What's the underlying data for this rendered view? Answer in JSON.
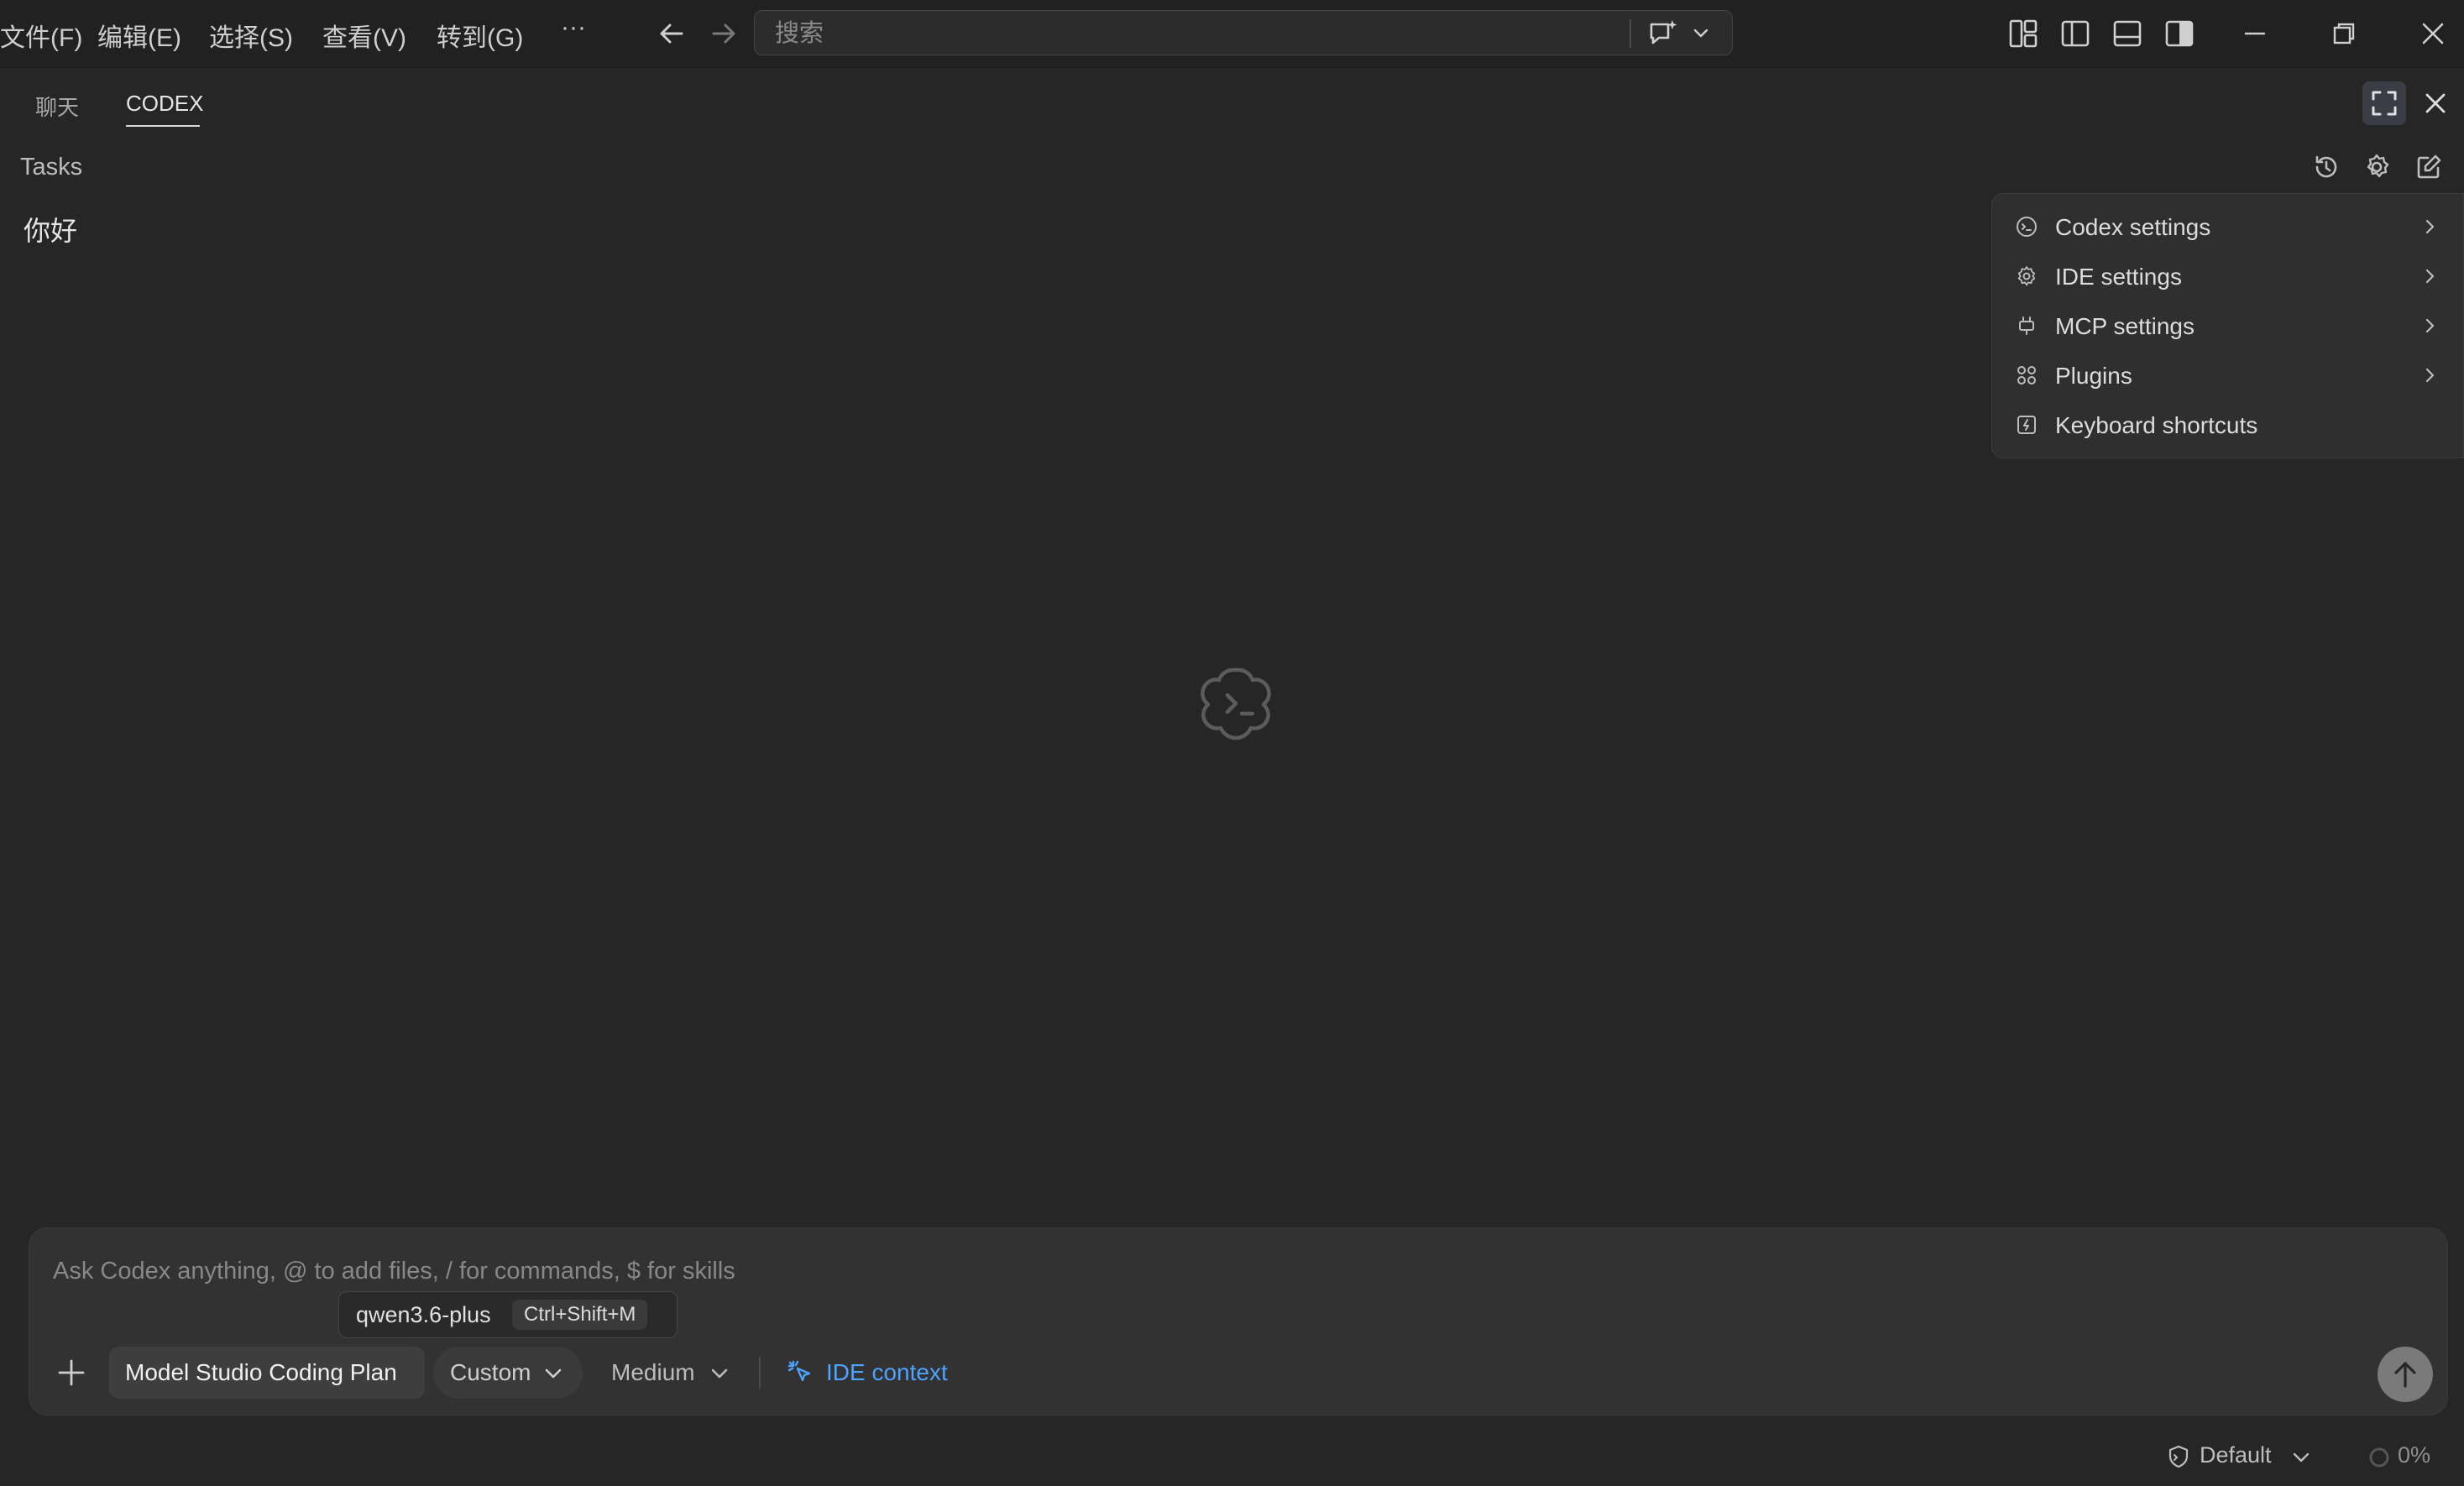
{
  "titlebar": {
    "menu": [
      "文件(F)",
      "编辑(E)",
      "选择(S)",
      "查看(V)",
      "转到(G)",
      "···"
    ],
    "search_placeholder": "搜索"
  },
  "panel": {
    "tabs": [
      "聊天",
      "CODEX"
    ],
    "active_tab": "CODEX",
    "tasks_title": "Tasks",
    "task_items": [
      "你好"
    ]
  },
  "settings_menu": {
    "items": [
      {
        "label": "Codex settings",
        "icon": "terminal-circle-icon",
        "has_submenu": true
      },
      {
        "label": "IDE settings",
        "icon": "gear-icon",
        "has_submenu": true
      },
      {
        "label": "MCP settings",
        "icon": "plug-icon",
        "has_submenu": true
      },
      {
        "label": "Plugins",
        "icon": "grid-icon",
        "has_submenu": true
      },
      {
        "label": "Keyboard shortcuts",
        "icon": "keyboard-shortcut-icon",
        "has_submenu": false
      }
    ]
  },
  "composer": {
    "placeholder": "Ask Codex anything, @ to add files, / for commands, $ for skills",
    "tooltip_model": "qwen3.6-plus",
    "tooltip_shortcut": "Ctrl+Shift+M",
    "provider": "Model Studio Coding Plan",
    "mode": "Custom",
    "reasoning": "Medium",
    "context": "IDE context"
  },
  "status": {
    "permission": "Default",
    "usage": "0%"
  },
  "colors": {
    "background": "#262626",
    "titlebar": "#212121",
    "accent": "#4da3ff",
    "menu_bg": "#2f2f2f"
  }
}
